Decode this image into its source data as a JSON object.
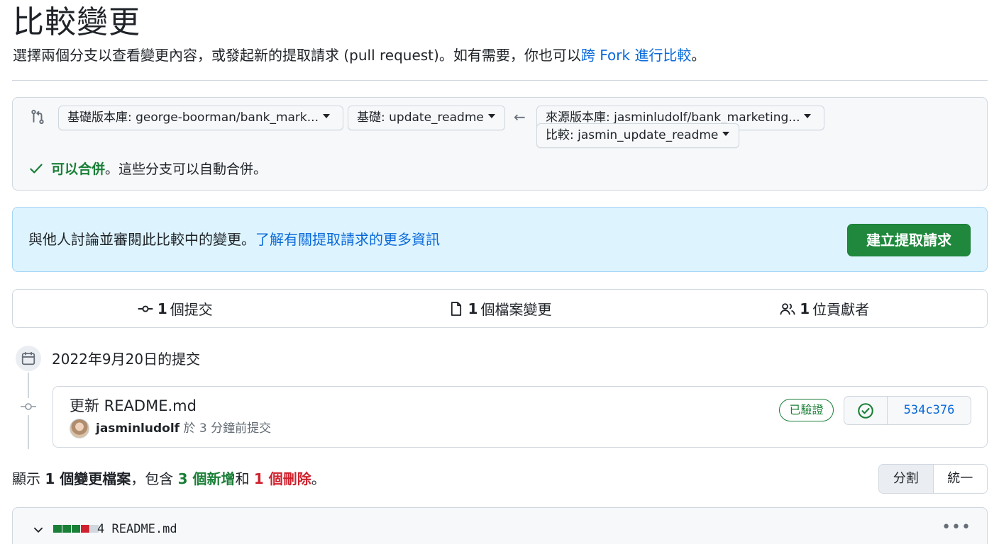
{
  "header": {
    "title": "比較變更",
    "subtitle_text": "選擇兩個分支以查看變更內容，或發起新的提取請求 (pull request)。如有需要，你也可以",
    "subtitle_link": "跨 Fork 進行比較",
    "subtitle_end": "。"
  },
  "range": {
    "base_repo": "基礎版本庫: george-boorman/bank_mark...",
    "base_branch": "基礎: update_readme",
    "arrow": "←",
    "head_repo": "來源版本庫: jasminludolf/bank_marketing...",
    "compare_branch": "比較: jasmin_update_readme",
    "merge_ok": "可以合併",
    "merge_rest": "。這些分支可以自動合併。"
  },
  "discuss": {
    "text": "與他人討論並審閱此比較中的變更。",
    "link": "了解有關提取請求的更多資訊",
    "button": "建立提取請求"
  },
  "stats": {
    "commits_count": "1",
    "commits_label": "個提交",
    "files_count": "1",
    "files_label": "個檔案變更",
    "contributors_count": "1",
    "contributors_label": "位貢獻者"
  },
  "timeline": {
    "date_heading": "2022年9月20日的提交",
    "commit": {
      "title": "更新 README.md",
      "author": "jasminludolf",
      "meta": "於 3 分鐘前提交",
      "verified": "已驗證",
      "sha": "534c376"
    }
  },
  "diff_summary": {
    "prefix": "顯示 ",
    "files": "1 個變更檔案",
    "mid": "，包含 ",
    "additions": "3 個新增",
    "and": "和 ",
    "deletions": "1 個刪除",
    "end": "。"
  },
  "view_toggle": {
    "split": "分割",
    "unified": "統一"
  },
  "file": {
    "changes": "4",
    "name": "README.md",
    "diffstat_colors": [
      "#1a7f37",
      "#1a7f37",
      "#1a7f37",
      "#cf222e",
      "#d0d7de"
    ]
  },
  "colors": {
    "accent": "#0969da",
    "success": "#1f883d",
    "danger": "#cf222e"
  }
}
